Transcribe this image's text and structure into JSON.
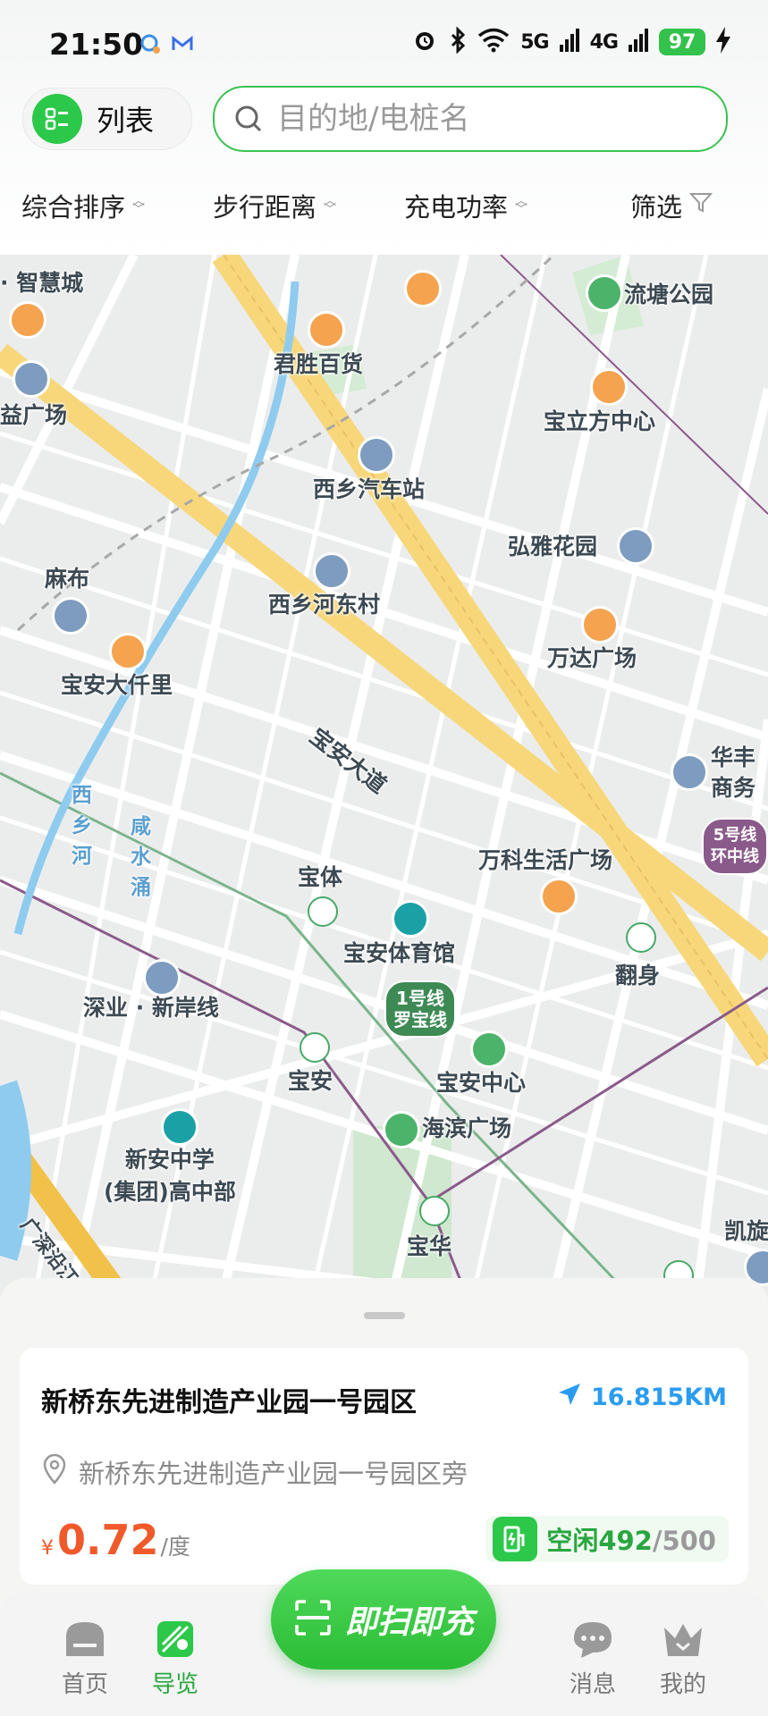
{
  "status_bar": {
    "time": "21:50",
    "signal_1": "5G",
    "signal_2": "4G",
    "battery": "97"
  },
  "header": {
    "list_label": "列表",
    "search_placeholder": "目的地/电桩名"
  },
  "filters": [
    {
      "label": "综合排序"
    },
    {
      "label": "步行距离"
    },
    {
      "label": "充电功率"
    },
    {
      "label": "筛选"
    }
  ],
  "map": {
    "labels": {
      "zhihuicheng": "· 智慧城",
      "liutang_park": "流塘公园",
      "junsheng": "君胜百货",
      "yiguangchang": "益广场",
      "baolifang": "宝立方中心",
      "xixiang_bus": "西乡汽车站",
      "hongya": "弘雅花园",
      "mabu": "麻布",
      "xixiang_hedong": "西乡河东村",
      "wanda": "万达广场",
      "baoan_daqianli": "宝安大仟里",
      "huafeng": "华丰",
      "shangwu": "商务",
      "baoan_dadao": "宝安大道",
      "xixiang_river": "西乡河",
      "xianshuiyong": "咸水涌",
      "baoti": "宝体",
      "wanke": "万科生活广场",
      "baoan_stadium": "宝安体育馆",
      "fanshen": "翻身",
      "shenye": "深业 · 新岸线",
      "baoan": "宝安",
      "baoan_center": "宝安中心",
      "xinan_school": "新安中学\n(集团)高中部",
      "haibin": "海滨广场",
      "baohua": "宝华",
      "kaixuan": "凯旋",
      "highway": "广深沿江高速",
      "line5": "5号线\n环中线",
      "line1": "1号线\n罗宝线"
    }
  },
  "station_card": {
    "name": "新桥东先进制造产业园一号园区",
    "distance": "16.815KM",
    "address": "新桥东先进制造产业园一号园区旁",
    "currency": "¥",
    "price": "0.72",
    "price_unit": "/度",
    "status": "空闲492",
    "total": "/500"
  },
  "scan_button": {
    "label": "即扫即充"
  },
  "bottom_nav": [
    {
      "label": "首页"
    },
    {
      "label": "导览"
    },
    {
      "label": "消息"
    },
    {
      "label": "我的"
    }
  ],
  "colors": {
    "accent": "#2cc84a",
    "price": "#f05a2a",
    "distance": "#2a9cf0"
  }
}
